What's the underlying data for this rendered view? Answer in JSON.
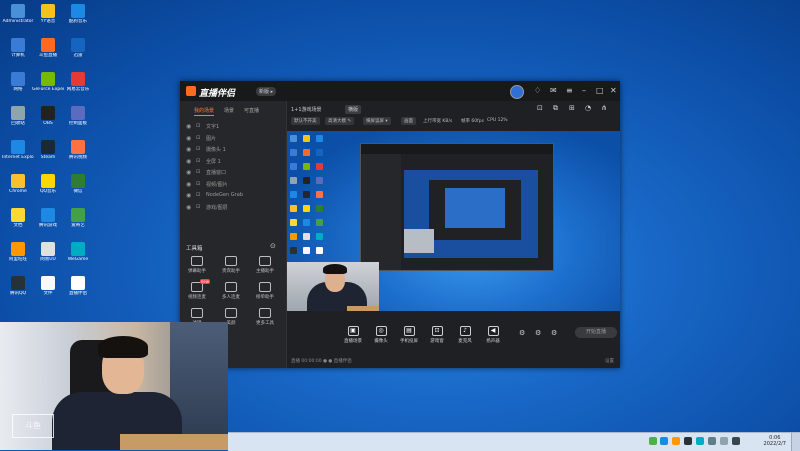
{
  "desktop": {
    "icons": [
      {
        "label": "Administrator",
        "color": "#4a90d9"
      },
      {
        "label": "YY语音",
        "color": "#f5c21b"
      },
      {
        "label": "酷狗音乐",
        "color": "#1e88e5"
      },
      {
        "label": "计算机",
        "color": "#3a7bd5"
      },
      {
        "label": "斗鱼直播",
        "color": "#ff6a1f"
      },
      {
        "label": "迅雷",
        "color": "#1565c0"
      },
      {
        "label": "网络",
        "color": "#3a7bd5"
      },
      {
        "label": "GeForce Experience",
        "color": "#76b900"
      },
      {
        "label": "网易云音乐",
        "color": "#e53935"
      },
      {
        "label": "回收站",
        "color": "#90a4ae"
      },
      {
        "label": "OBS",
        "color": "#222222"
      },
      {
        "label": "控制面板",
        "color": "#5c6bc0"
      },
      {
        "label": "Internet Explorer",
        "color": "#1e88e5"
      },
      {
        "label": "Steam",
        "color": "#1b2838"
      },
      {
        "label": "腾讯视频",
        "color": "#ff7043"
      },
      {
        "label": "Chrome",
        "color": "#fbc02d"
      },
      {
        "label": "QQ音乐",
        "color": "#ffd600"
      },
      {
        "label": "微信",
        "color": "#2e7d32"
      },
      {
        "label": "文档",
        "color": "#fdd835"
      },
      {
        "label": "腾讯游戏",
        "color": "#1e88e5"
      },
      {
        "label": "爱奇艺",
        "color": "#43a047"
      },
      {
        "label": "阿里旺旺",
        "color": "#ff9800"
      },
      {
        "label": "网易UU",
        "color": "#e0e0e0"
      },
      {
        "label": "WeGame",
        "color": "#00acc1"
      },
      {
        "label": "腾讯QQ",
        "color": "#263238"
      },
      {
        "label": "文件",
        "color": "#fafafa"
      },
      {
        "label": "直播伴侣",
        "color": "#ffffff"
      }
    ]
  },
  "app": {
    "title": "直播伴侣",
    "version_badge": "新版 ▸",
    "left_tabs": [
      "我的场景",
      "场景",
      "可直播"
    ],
    "scene_items": [
      "文字1",
      "图片",
      "摄像头 1",
      "全屏 1",
      "直播窗口",
      "视频/图片",
      "NodeGen Grab",
      "游戏/图层"
    ],
    "toolbox_title": "工具箱",
    "tools": [
      "弹幕助手",
      "贵宾助手",
      "主播助手",
      "视频连麦",
      "多人连麦",
      "榜单助手",
      "滤镜",
      "美颜",
      "更多工具"
    ],
    "new_badge": "new",
    "scene_title": "1+1游戏场景",
    "scene_tag": "横版",
    "filter_chips": [
      "默认不开美",
      "高清大模 ✎",
      "横屏竖屏 ▾",
      "画面"
    ],
    "stats": [
      "上行带宽 KB/s",
      "帧率 60fps",
      "CPU 12%"
    ],
    "bottom_tools": [
      "直播场景",
      "摄像头",
      "手机投屏",
      "游戏窗",
      "麦克风",
      "扬声器"
    ],
    "live_button": "开始直播",
    "status_left": "直播 00:00:00  ●  ●  直播伴侣",
    "status_right": "设置"
  },
  "taskbar": {
    "clock_time": "0:06",
    "clock_date": "2022/2/7"
  }
}
